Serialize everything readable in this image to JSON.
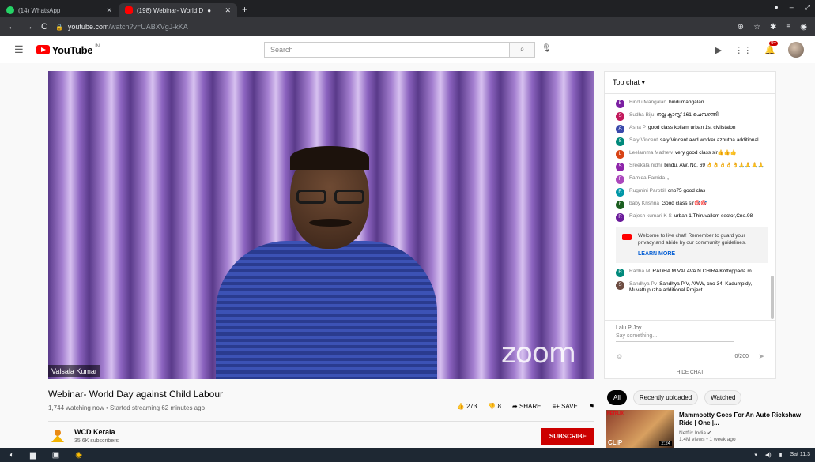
{
  "browser": {
    "tabs": [
      {
        "label": "(14) WhatsApp",
        "icon": "whatsapp-icon"
      },
      {
        "label": "(198) Webinar- World D",
        "icon": "youtube-icon",
        "live_indicator": "●"
      }
    ],
    "new_tab": "+",
    "window_controls": {
      "minimize": "–",
      "maximize": "⤢"
    },
    "url_domain": "youtube.com",
    "url_rest": "/watch?v=UABXVgJ-kKA"
  },
  "header": {
    "logo": "YouTube",
    "logo_region": "IN",
    "search_placeholder": "Search",
    "notifications_badge": "9+"
  },
  "video": {
    "speaker_label": "Valsala Kumar",
    "watermark": "zoom",
    "title": "Webinar- World Day against Child Labour",
    "stats": "1,744 watching now • Started streaming 62 minutes ago",
    "likes": "273",
    "dislikes": "8",
    "share": "SHARE",
    "save": "SAVE"
  },
  "channel": {
    "name": "WCD Kerala",
    "subscribers": "35.6K subscribers",
    "subscribe": "SUBSCRIBE"
  },
  "chat": {
    "header": "Top chat",
    "messages": [
      {
        "author": "Bindu Mangalan",
        "text": "bindumangalan",
        "initial": "B",
        "color": "#7b1fa2"
      },
      {
        "author": "Sudha Biju",
        "text": "നല്ല ക്ലാസ്സ് 161 ചെമ്പഴന്തി",
        "initial": "S",
        "color": "#c2185b"
      },
      {
        "author": "Asha P",
        "text": "good class kollam urban 1st civilstaion",
        "initial": "A",
        "color": "#3949ab"
      },
      {
        "author": "Saly Vincent",
        "text": "saly Vincent awd worker azhutha additional",
        "initial": "S",
        "color": "#00897b"
      },
      {
        "author": "Leelamma Mathew",
        "text": "very good class sir👍👍👍",
        "initial": "L",
        "color": "#d84315"
      },
      {
        "author": "Sreekala nidhi",
        "text": "bindu, AW. No. 69 👌👌👌👌👌🙏🙏🙏🙏",
        "initial": "S",
        "color": "#8e24aa"
      },
      {
        "author": "Famida Famida",
        "text": ",",
        "initial": "F",
        "color": "#ab47bc"
      },
      {
        "author": "Rugmini Parottil",
        "text": "cno75 good clas",
        "initial": "R",
        "color": "#0097a7"
      },
      {
        "author": "baby Krishna",
        "text": "Good class sir🎯🎯",
        "initial": "b",
        "color": "#1b5e20"
      },
      {
        "author": "Rajesh kumari K S",
        "text": "urban 1,Thiruvallom sector,Cno.98",
        "initial": "R",
        "color": "#6a1b9a"
      }
    ],
    "welcome": "Welcome to live chat! Remember to guard your privacy and abide by our community guidelines.",
    "learn_more": "LEARN MORE",
    "messages_after": [
      {
        "author": "Radha M",
        "text": "RADHA M VALAVA N CHIRA Kottoppada m",
        "initial": "R",
        "color": "#00897b"
      },
      {
        "author": "Sandhya Pv",
        "text": "Sandhya P V, AWW, cno 34, Kadumpidy, Muvattupuzha additional Project.",
        "initial": "S",
        "color": "#6d4c41"
      }
    ],
    "current_user": "Lalu P Joy",
    "input_placeholder": "Say something...",
    "char_count": "0/200",
    "hide_chat": "HIDE CHAT"
  },
  "chips": [
    "All",
    "Recently uploaded",
    "Watched"
  ],
  "recommendation": {
    "title": "Mammootty Goes For An Auto Rickshaw Ride | One |...",
    "channel": "Netflix India ✔",
    "meta": "1.4M views • 1 week ago",
    "thumb_brand": "NETFLIX",
    "thumb_label": "CLIP",
    "duration": "2:24"
  },
  "taskbar": {
    "time": "Sat 11:3"
  }
}
